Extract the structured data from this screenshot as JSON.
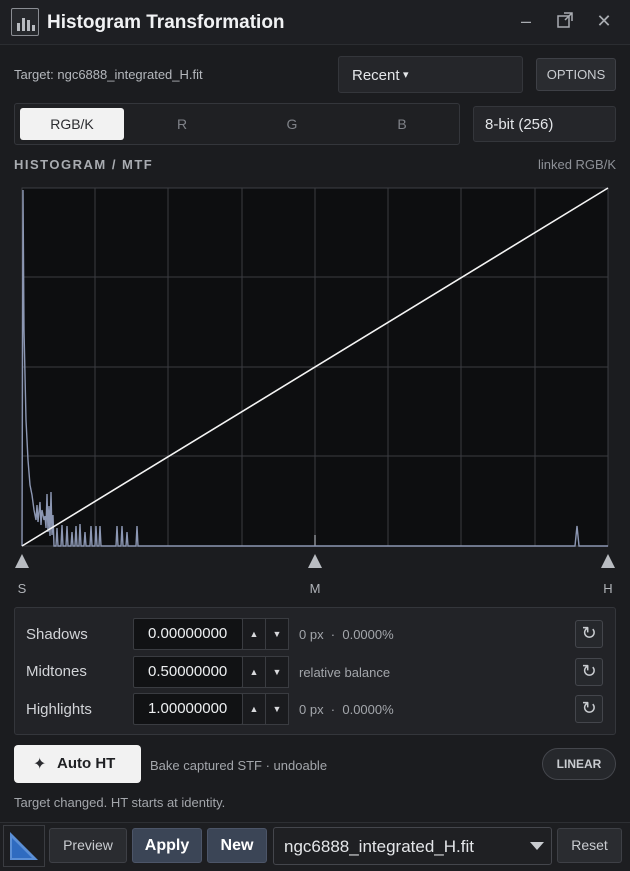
{
  "window": {
    "title": "Histogram Transformation"
  },
  "target": {
    "label": "Target: ngc6888_integrated_H.fit"
  },
  "recent": {
    "label": "Recent",
    "arrow": "▾"
  },
  "options_label": "OPTIONS",
  "channels": {
    "tabs": [
      "RGB/K",
      "R",
      "G",
      "B"
    ],
    "selected": "RGB/K"
  },
  "bit_depth": "8-bit (256)",
  "histogram": {
    "title": "HISTOGRAM / MTF",
    "linked": "linked RGB/K",
    "markers": {
      "s": "S",
      "m": "M",
      "h": "H"
    }
  },
  "params": {
    "shadows": {
      "label": "Shadows",
      "value": "0.00000000",
      "info": "0 px  ·  0.0000%"
    },
    "midtones": {
      "label": "Midtones",
      "value": "0.50000000",
      "info": "relative balance"
    },
    "highlights": {
      "label": "Highlights",
      "value": "1.00000000",
      "info": "0 px  ·  0.0000%"
    }
  },
  "auto": {
    "label": "Auto HT",
    "note": "Bake captured STF · undoable",
    "linear_label": "LINEAR"
  },
  "status": "Target changed. HT starts at identity.",
  "footer": {
    "preview": "Preview",
    "apply": "Apply",
    "new": "New",
    "view": "ngc6888_integrated_H.fit",
    "reset": "Reset"
  },
  "colors": {
    "accent": "#3b4556",
    "histogram_line": "#8c97b3",
    "mtf_curve": "#f4f4f4"
  }
}
